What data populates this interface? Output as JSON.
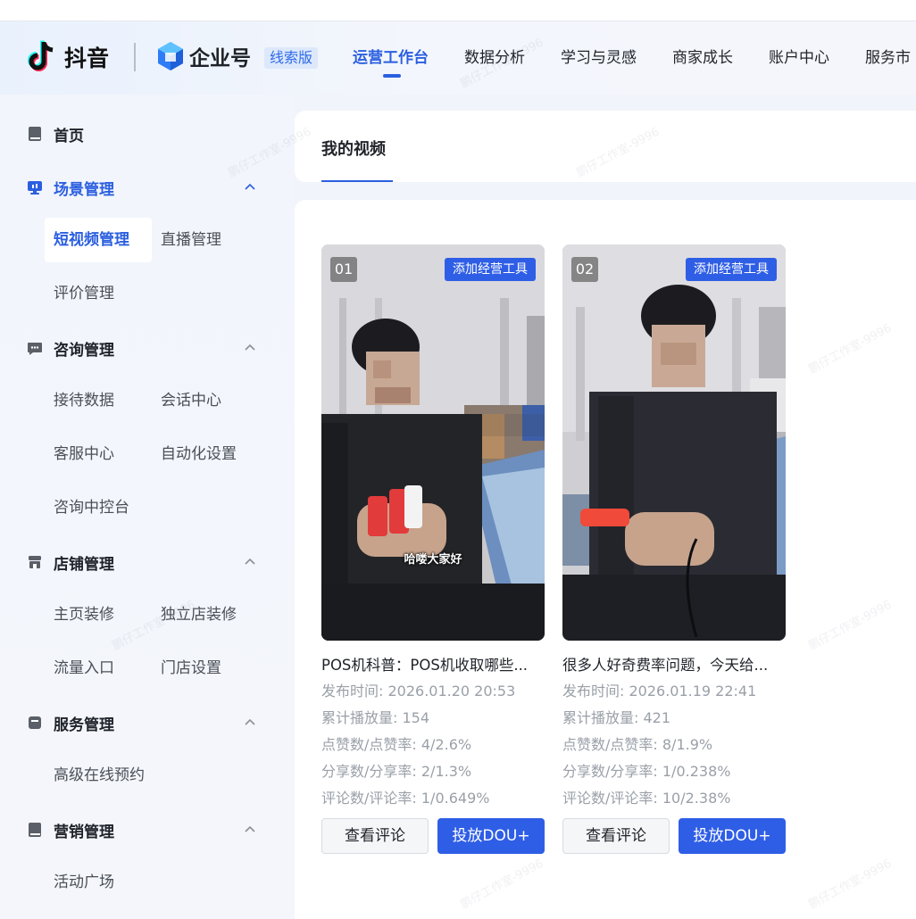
{
  "header": {
    "brand": "抖音",
    "product": "企业号",
    "edition": "线索版",
    "nav": [
      "运营工作台",
      "数据分析",
      "学习与灵感",
      "商家成长",
      "账户中心",
      "服务市"
    ]
  },
  "sidebar": {
    "home": "首页",
    "groups": {
      "scene": {
        "label": "场景管理",
        "items": [
          "短视频管理",
          "直播管理",
          "评价管理"
        ]
      },
      "consult": {
        "label": "咨询管理",
        "items": [
          "接待数据",
          "会话中心",
          "客服中心",
          "自动化设置",
          "咨询中控台"
        ]
      },
      "store": {
        "label": "店铺管理",
        "items": [
          "主页装修",
          "独立店装修",
          "流量入口",
          "门店设置"
        ]
      },
      "service": {
        "label": "服务管理",
        "items": [
          "高级在线预约"
        ]
      },
      "marketing": {
        "label": "营销管理",
        "items": [
          "活动广场"
        ]
      }
    }
  },
  "main": {
    "title": "我的视频",
    "videos": [
      {
        "index": "01",
        "tool": "添加经营工具",
        "caption": "哈喽大家好",
        "title": "POS机科普：POS机收取哪些...",
        "publish": "发布时间: 2026.01.20 20:53",
        "plays": "累计播放量: 154",
        "likes": "点赞数/点赞率: 4/2.6%",
        "shares": "分享数/分享率: 2/1.3%",
        "comments": "评论数/评论率: 1/0.649%",
        "btn_comment": "查看评论",
        "btn_promote": "投放DOU+"
      },
      {
        "index": "02",
        "tool": "添加经营工具",
        "caption": "",
        "title": "很多人好奇费率问题，今天给...",
        "publish": "发布时间: 2026.01.19 22:41",
        "plays": "累计播放量: 421",
        "likes": "点赞数/点赞率: 8/1.9%",
        "shares": "分享数/分享率: 1/0.238%",
        "comments": "评论数/评论率: 10/2.38%",
        "btn_comment": "查看评论",
        "btn_promote": "投放DOU+"
      }
    ]
  },
  "watermark": "鹏仔工作室-9996",
  "colors": {
    "accent": "#2b5fe0",
    "button_primary": "#2f5ee6",
    "muted_text": "#9aa0a8"
  }
}
